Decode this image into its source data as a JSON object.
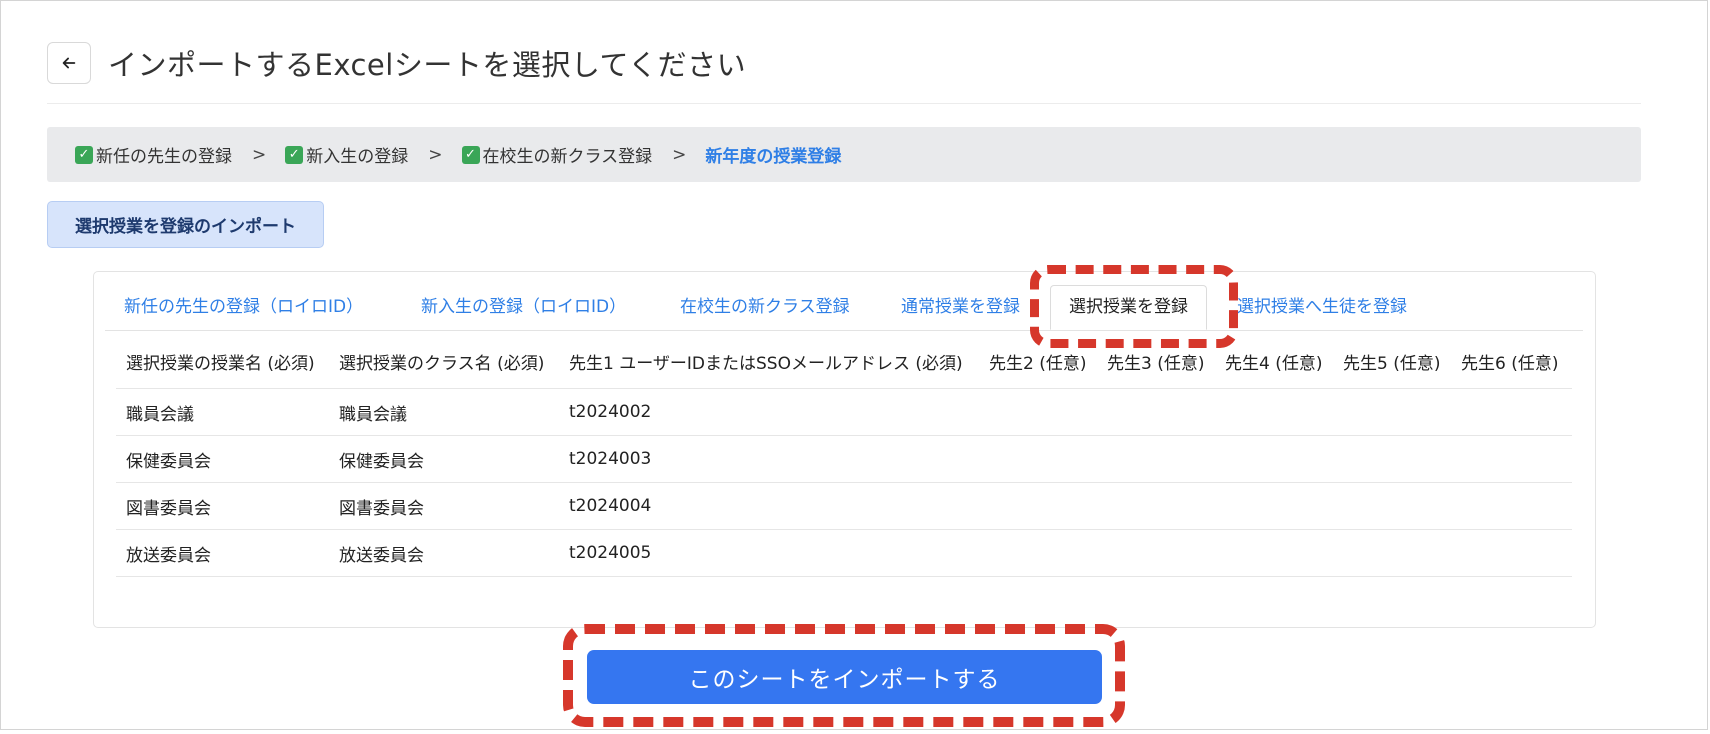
{
  "header": {
    "title": "インポートするExcelシートを選択してください",
    "back_icon": "arrow-left-icon"
  },
  "breadcrumb": {
    "steps": [
      {
        "label": "新任の先生の登録",
        "done": true
      },
      {
        "label": "新入生の登録",
        "done": true
      },
      {
        "label": "在校生の新クラス登録",
        "done": true
      },
      {
        "label": "新年度の授業登録",
        "done": false,
        "current": true
      }
    ],
    "separator": ">"
  },
  "import_label": "選択授業を登録のインポート",
  "tabs": [
    {
      "label": "新任の先生の登録（ロイロID）",
      "active": false
    },
    {
      "label": "新入生の登録（ロイロID）",
      "active": false
    },
    {
      "label": "在校生の新クラス登録",
      "active": false
    },
    {
      "label": "通常授業を登録",
      "active": false
    },
    {
      "label": "選択授業を登録",
      "active": true
    },
    {
      "label": "選択授業へ生徒を登録",
      "active": false
    }
  ],
  "table": {
    "headers": [
      "選択授業の授業名 (必須)",
      "選択授業のクラス名 (必須)",
      "先生1 ユーザーIDまたはSSOメールアドレス (必須)",
      "先生2 (任意)",
      "先生3 (任意)",
      "先生4 (任意)",
      "先生5 (任意)",
      "先生6 (任意)"
    ],
    "rows": [
      [
        "職員会議",
        "職員会議",
        "t2024002",
        "",
        "",
        "",
        "",
        ""
      ],
      [
        "保健委員会",
        "保健委員会",
        "t2024003",
        "",
        "",
        "",
        "",
        ""
      ],
      [
        "図書委員会",
        "図書委員会",
        "t2024004",
        "",
        "",
        "",
        "",
        ""
      ],
      [
        "放送委員会",
        "放送委員会",
        "t2024005",
        "",
        "",
        "",
        "",
        ""
      ]
    ]
  },
  "primary_button": "このシートをインポートする",
  "colors": {
    "accent": "#3576f0",
    "link": "#2f7fe6",
    "highlight": "#d6372b",
    "check": "#3aa657"
  }
}
